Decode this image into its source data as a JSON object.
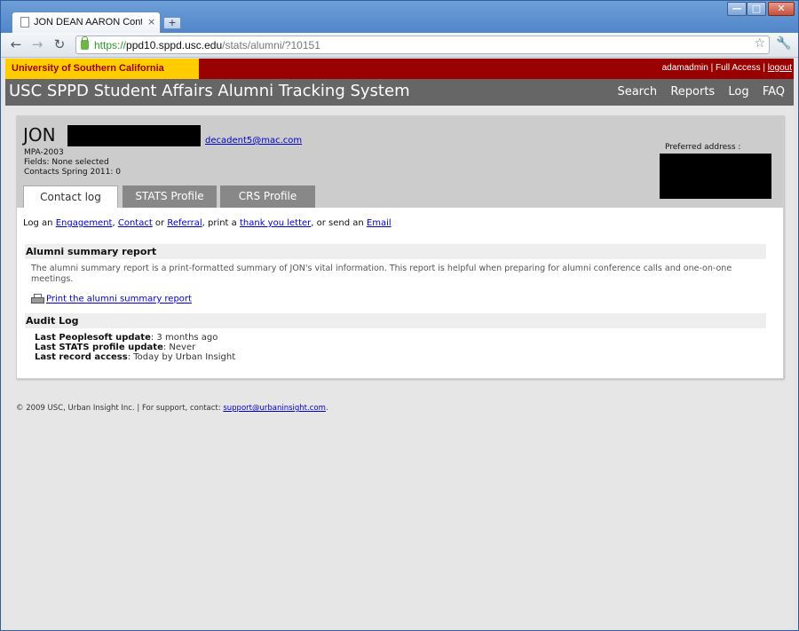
{
  "browser": {
    "tab_title": "JON DEAN AARON Contact...",
    "tab_close": "×",
    "new_tab": "+",
    "window_min": "—",
    "window_max": "□",
    "window_close": "✕",
    "url_proto": "https://",
    "url_host": "ppd10.sppd.usc.edu",
    "url_path": "/stats/alumni/?10151"
  },
  "header": {
    "university": "University of Southern California",
    "username": "adamadmin",
    "separator1": " | ",
    "access": "Full Access",
    "separator2": " | ",
    "logout": "logout",
    "system_title": "USC SPPD Student Affairs Alumni Tracking System",
    "nav": [
      "Search",
      "Reports",
      "Log",
      "FAQ"
    ]
  },
  "profile": {
    "first_name": "JON",
    "email": "decadent5@mac.com",
    "program": "MPA-2003",
    "fields": "Fields: None selected",
    "contacts": "Contacts Spring 2011: 0",
    "preferred_address_label": "Preferred address :"
  },
  "tabs": [
    "Contact log",
    "STATS Profile",
    "CRS Profile"
  ],
  "actions": {
    "prefix": "Log an ",
    "engagement": "Engagement",
    "sep1": ", ",
    "contact": "Contact",
    "or": " or ",
    "referral": "Referral",
    "print_a": ", print a ",
    "thank_you": "thank you letter",
    "send_an": ", or send an ",
    "email": "Email"
  },
  "summary": {
    "heading": "Alumni summary report",
    "description": "The alumni summary report is a print-formatted summary of JON's vital information. This report is helpful when preparing for alumni conference calls and one-on-one meetings.",
    "print_link": "Print the alumni summary report"
  },
  "audit": {
    "heading": "Audit Log",
    "rows": [
      {
        "label": "Last Peoplesoft update",
        "value": ": 3 months ago"
      },
      {
        "label": "Last STATS profile update",
        "value": ": Never"
      },
      {
        "label": "Last record access",
        "value": ": Today by Urban Insight"
      }
    ]
  },
  "footer": {
    "text": "© 2009 USC, Urban Insight Inc. | For support, contact: ",
    "support_email": "support@urbaninsight.com",
    "end": "."
  }
}
